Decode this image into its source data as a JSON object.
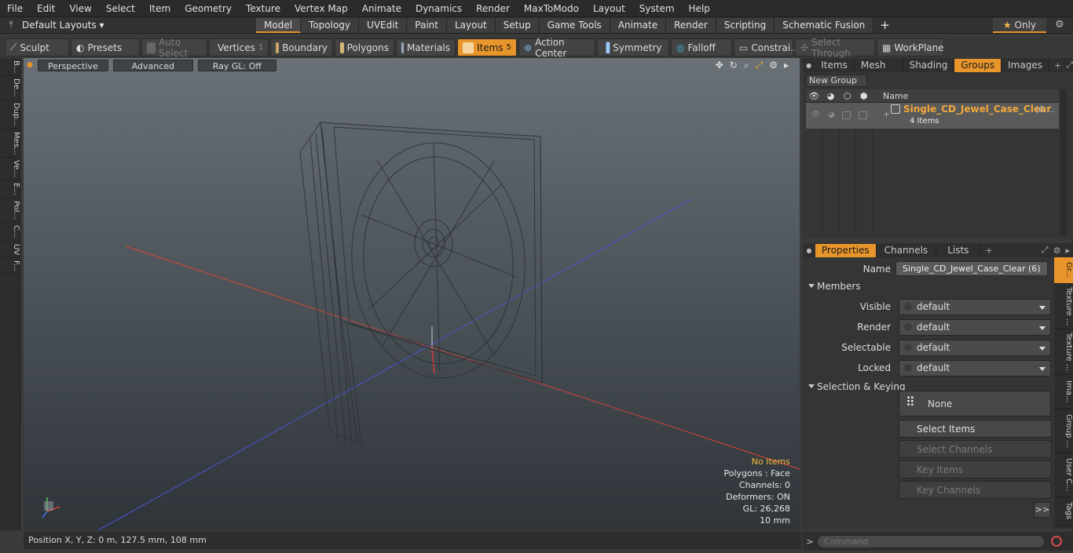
{
  "menu": [
    "File",
    "Edit",
    "View",
    "Select",
    "Item",
    "Geometry",
    "Texture",
    "Vertex Map",
    "Animate",
    "Dynamics",
    "Render",
    "MaxToModo",
    "Layout",
    "System",
    "Help"
  ],
  "layout": {
    "dropdown": "Default Layouts",
    "tabs": [
      "Model",
      "Topology",
      "UVEdit",
      "Paint",
      "Layout",
      "Setup",
      "Game Tools",
      "Animate",
      "Render",
      "Scripting",
      "Schematic Fusion"
    ],
    "active_tab": "Model",
    "plus": "+",
    "only": "Only"
  },
  "toolbar": {
    "sculpt": "Sculpt",
    "presets": "Presets",
    "auto_select": "Auto Select",
    "vertices": "Vertices",
    "vertices_count": "1",
    "boundary": "Boundary",
    "polygons": "Polygons",
    "materials": "Materials",
    "items": "Items",
    "items_count": "5",
    "action_center": "Action Center",
    "symmetry": "Symmetry",
    "falloff": "Falloff",
    "constraints": "Constrai...",
    "select_through": "Select Through",
    "workplane": "WorkPlane"
  },
  "left_strip": [
    "B...",
    "De...",
    "Dup...",
    "Mes...",
    "Ve...",
    "E...",
    "Pol...",
    "C...",
    "UV",
    "F..."
  ],
  "viewport": {
    "perspective": "Perspective",
    "advanced": "Advanced",
    "raygl": "Ray GL: Off",
    "hud": {
      "no_items": "No Items",
      "polygons": "Polygons : Face",
      "channels": "Channels: 0",
      "deformers": "Deformers: ON",
      "gl": "GL: 26,268",
      "scale": "10 mm"
    }
  },
  "status": {
    "position": "Position X, Y, Z:   0 m, 127.5 mm, 108 mm"
  },
  "right_top": {
    "tabs": [
      "Items",
      "Mesh ...",
      "Shading",
      "Groups",
      "Images"
    ],
    "active": "Groups",
    "new_group": "New Group",
    "col_name": "Name",
    "group_name": "Single_CD_Jewel_Case_Clear",
    "group_suffix": "(6 ...",
    "group_sub": "4 Items"
  },
  "props": {
    "tabs": [
      "Properties",
      "Channels",
      "Lists"
    ],
    "active": "Properties",
    "name_label": "Name",
    "name_value": "Single_CD_Jewel_Case_Clear (6)",
    "members": "Members",
    "visible_label": "Visible",
    "visible": "default",
    "render_label": "Render",
    "render": "default",
    "selectable_label": "Selectable",
    "selectable": "default",
    "locked_label": "Locked",
    "locked": "default",
    "sel_keying": "Selection & Keying",
    "none": "None",
    "select_items": "Select Items",
    "select_channels": "Select Channels",
    "key_items": "Key Items",
    "key_channels": "Key Channels",
    "more": ">>"
  },
  "vtabs": [
    "Gr...",
    "Texture ...",
    "Texture ...",
    "Ima...",
    "Group ...",
    "User C...",
    "Tags"
  ],
  "command": {
    "prompt": ">",
    "placeholder": "Command"
  }
}
